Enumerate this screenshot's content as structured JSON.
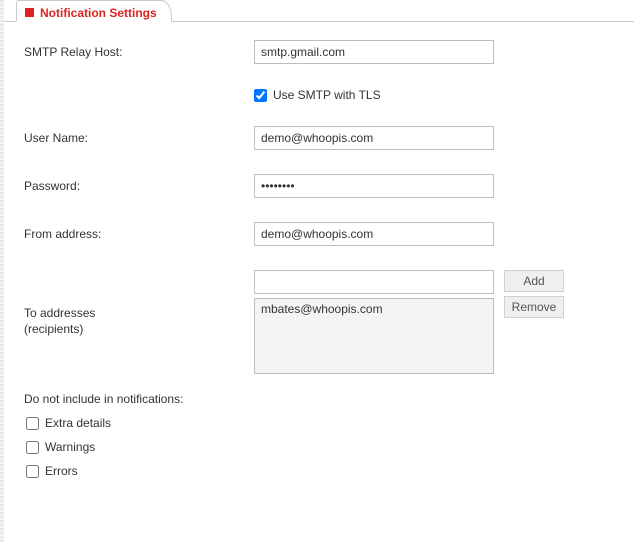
{
  "tab_title": "Notification Settings",
  "fields": {
    "smtp_host_label": "SMTP Relay Host:",
    "smtp_host_value": "smtp.gmail.com",
    "tls_label": "Use SMTP with TLS",
    "tls_checked": true,
    "username_label": "User Name:",
    "username_value": "demo@whoopis.com",
    "password_label": "Password:",
    "password_value": "••••••••",
    "from_label": "From address:",
    "from_value": "demo@whoopis.com",
    "recipients_label_line1": "To addresses",
    "recipients_label_line2": "(recipients)",
    "recipient_input_value": "",
    "recipients": [
      "mbates@whoopis.com"
    ],
    "add_button": "Add",
    "remove_button": "Remove"
  },
  "exclude": {
    "title": "Do not include in notifications:",
    "options": [
      {
        "label": "Extra details",
        "checked": false
      },
      {
        "label": "Warnings",
        "checked": false
      },
      {
        "label": "Errors",
        "checked": false
      }
    ]
  }
}
